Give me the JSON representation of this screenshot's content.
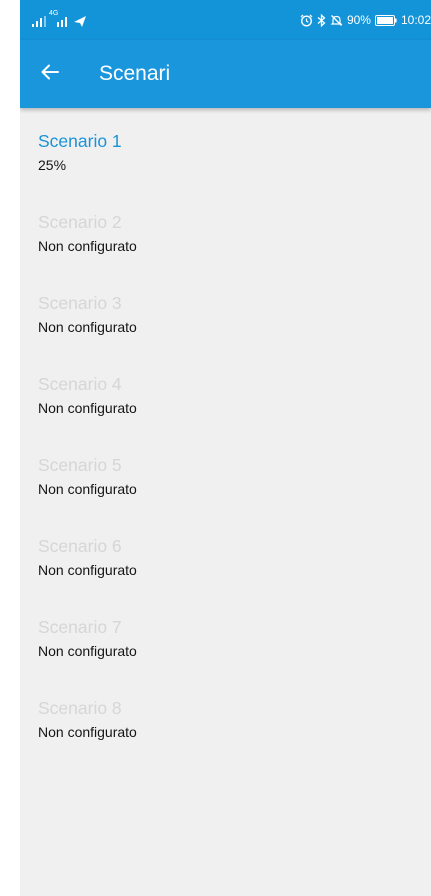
{
  "status_bar": {
    "network_label": "4G",
    "battery_percent": "90%",
    "time": "10:02",
    "icons": [
      "signal-icon",
      "network-4g-icon",
      "location-arrow-icon",
      "alarm-icon",
      "bluetooth-icon",
      "mute-icon",
      "battery-icon"
    ]
  },
  "app_bar": {
    "title": "Scenari",
    "back_icon": "back-arrow-icon",
    "color": "#1a96dd"
  },
  "scenarios": [
    {
      "name": "Scenario 1",
      "status": "25%",
      "active": true
    },
    {
      "name": "Scenario 2",
      "status": "Non configurato",
      "active": false
    },
    {
      "name": "Scenario 3",
      "status": "Non configurato",
      "active": false
    },
    {
      "name": "Scenario 4",
      "status": "Non configurato",
      "active": false
    },
    {
      "name": "Scenario 5",
      "status": "Non configurato",
      "active": false
    },
    {
      "name": "Scenario 6",
      "status": "Non configurato",
      "active": false
    },
    {
      "name": "Scenario 7",
      "status": "Non configurato",
      "active": false
    },
    {
      "name": "Scenario 8",
      "status": "Non configurato",
      "active": false
    }
  ],
  "colors": {
    "accent": "#1a96dd",
    "active_name": "#1a93d8",
    "inactive_name": "#d6d6d6",
    "background": "#f0f0f0"
  }
}
